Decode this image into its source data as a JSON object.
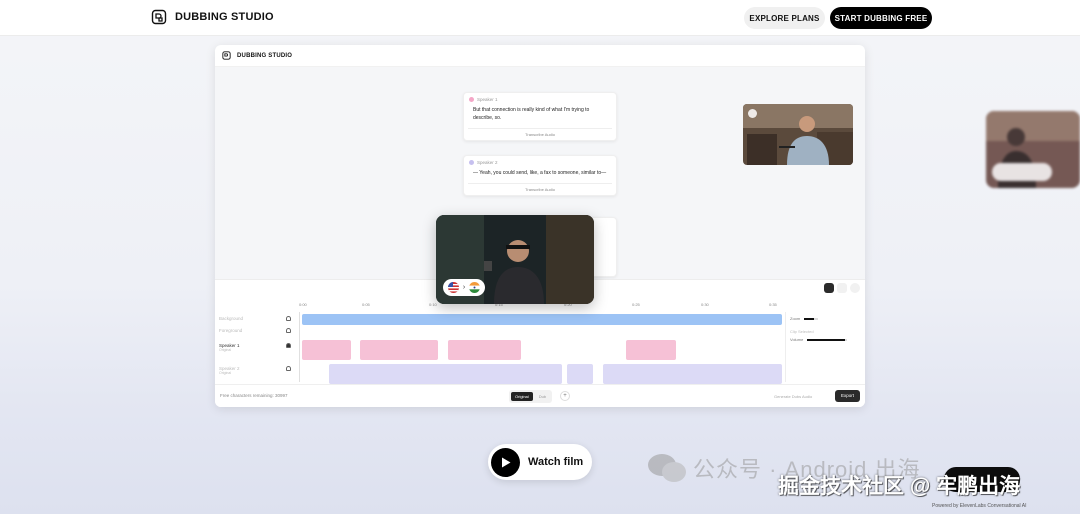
{
  "nav": {
    "brand": "DUBBING STUDIO",
    "explore_label": "EXPLORE PLANS",
    "start_label": "START DUBBING FREE"
  },
  "app": {
    "title": "DUBBING STUDIO",
    "cards": [
      {
        "speaker": "Speaker 1",
        "color": "#f4a7c7",
        "text": "But that connection is really kind of what I'm trying to describe, so.",
        "footer": "Transcribe Audio"
      },
      {
        "speaker": "Speaker 2",
        "color": "#c6c0ef",
        "text": "— Yeah, you could send, like, a fax to someone, similar to—",
        "footer": "Transcribe Audio"
      }
    ],
    "timeline": {
      "ruler": [
        "0:00",
        "0:05",
        "0:10",
        "0:15",
        "0:20",
        "0:25",
        "0:30",
        "0:35"
      ],
      "tracks": [
        {
          "label": "Background",
          "sub": ""
        },
        {
          "label": "Foreground",
          "sub": ""
        },
        {
          "label": "Speaker 1",
          "sub": "Original"
        },
        {
          "label": "Speaker 2",
          "sub": "Original"
        }
      ],
      "side": {
        "zoom_label": "Zoom",
        "clip_label": "Clip Selected",
        "volume_label": "Volume"
      }
    },
    "footer": {
      "chars": "Free characters remaining: 30997",
      "toggle_on": "Original",
      "toggle_off": "Dub",
      "plus": "+",
      "generate": "Generate Dubs Audio",
      "export": "Export"
    }
  },
  "watch_film": "Watch film",
  "watermark_1": "公众号 · Android 出海",
  "watermark_2": "掘金技术社区 @ 牢鹏出海",
  "powered": "Powered by ElevenLabs Conversational AI",
  "colors": {
    "speaker1": "#f4a7c7",
    "speaker2": "#c6c0ef",
    "background_track": "#9cc3f5",
    "accent": "#000000"
  }
}
